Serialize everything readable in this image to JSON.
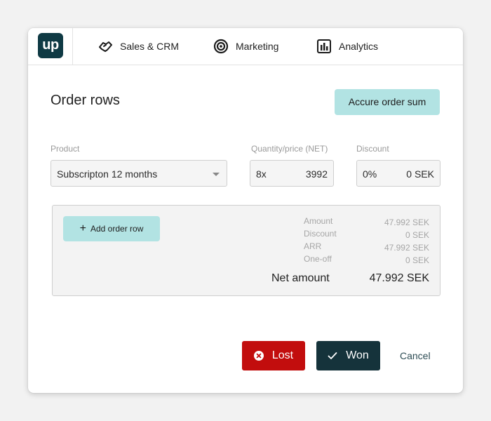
{
  "nav": {
    "logo_text": "up",
    "items": [
      {
        "label": "Sales & CRM",
        "icon": "handshake-icon"
      },
      {
        "label": "Marketing",
        "icon": "target-icon"
      },
      {
        "label": "Analytics",
        "icon": "bar-chart-icon"
      }
    ]
  },
  "header": {
    "title": "Order rows",
    "accure_button_label": "Accure order sum"
  },
  "fields": {
    "product_label": "Product",
    "product_value": "Subscripton 12 months",
    "quantity_label": "Quantity/price (NET)",
    "quantity_value": "8x",
    "price_value": "3992",
    "discount_label": "Discount",
    "discount_percent": "0%",
    "discount_amount": "0 SEK"
  },
  "summary": {
    "add_row_label": "Add order row",
    "rows": [
      {
        "label": "Amount",
        "value": "47.992 SEK"
      },
      {
        "label": "Discount",
        "value": "0 SEK"
      },
      {
        "label": "ARR",
        "value": "47.992 SEK"
      },
      {
        "label": "One-off",
        "value": "0 SEK"
      }
    ],
    "net_label": "Net amount",
    "net_value": "47.992 SEK"
  },
  "actions": {
    "lost_label": "Lost",
    "won_label": "Won",
    "cancel_label": "Cancel"
  },
  "colors": {
    "brand": "#0f3a44",
    "accent_teal": "#b2e3e3",
    "lost_red": "#c20d0d",
    "won_dark": "#15333b"
  }
}
